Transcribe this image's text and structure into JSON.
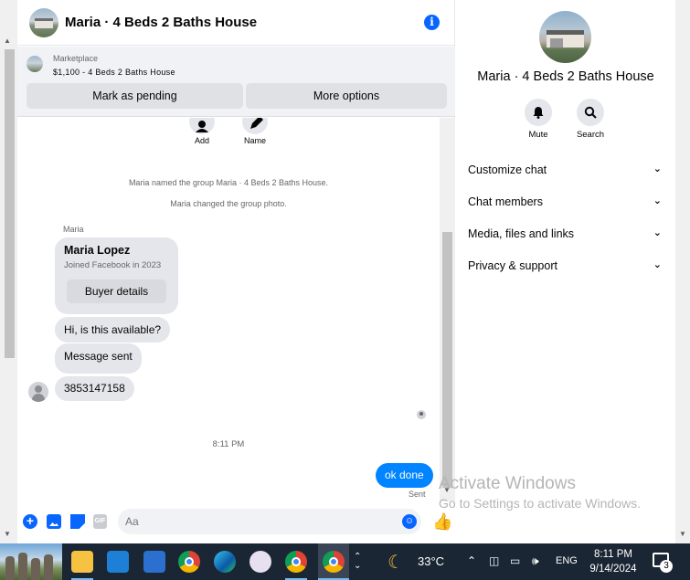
{
  "header": {
    "title": "Maria · 4 Beds 2 Baths House"
  },
  "marketplace": {
    "label": "Marketplace",
    "listing": "$1,100 - 4 Beds 2 Baths House",
    "mark_pending": "Mark as pending",
    "more_options": "More options"
  },
  "chat_actions": {
    "add": "Add",
    "name": "Name"
  },
  "messages": {
    "system_1": "Maria named the group Maria · 4 Beds 2 Baths House.",
    "system_2": "Maria changed the group photo.",
    "sender": "Maria",
    "card_name": "Maria Lopez",
    "card_joined": "Joined Facebook in 2023",
    "buyer_details": "Buyer details",
    "msg_available": "Hi, is this available?",
    "msg_sent": "Message sent",
    "msg_phone": "3853147158",
    "time": "8:11 PM",
    "own_msg": "ok done",
    "own_status": "Sent"
  },
  "composer": {
    "placeholder": "Aa",
    "gif": "GIF"
  },
  "right_panel": {
    "title": "Maria · 4 Beds 2 Baths House",
    "mute": "Mute",
    "search": "Search",
    "rows": [
      "Customize chat",
      "Chat members",
      "Media, files and links",
      "Privacy & support"
    ]
  },
  "watermark": {
    "line1": "Activate Windows",
    "line2": "Go to Settings to activate Windows."
  },
  "taskbar": {
    "temperature": "33°C",
    "language": "ENG",
    "time": "8:11 PM",
    "date": "9/14/2024",
    "notifications": "3"
  },
  "colors": {
    "accent": "#0866ff",
    "own_bubble": "#0084ff",
    "taskbar": "#1b2634"
  }
}
